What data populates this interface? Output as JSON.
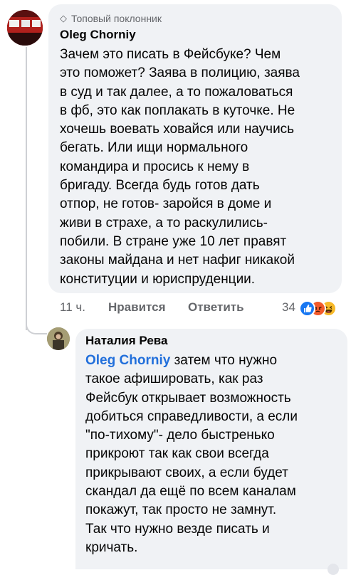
{
  "comment": {
    "badge": "Топовый поклонник",
    "author": "Oleg Chorniy",
    "lines": [
      "Зачем это писать в Фейсбуке? Чем",
      "это поможет? Заява в полицию, заява",
      "в суд и так далее, а то пожаловаться",
      "в фб, это как поплакать в куточке. Не",
      "хочешь воевать ховайся или научись",
      "бегать. Или ищи нормального",
      "командира и просись к нему в",
      "бригаду. Всегда будь готов дать",
      "отпор, не готов- заройся в доме и",
      "живи в страхе, а то раскулились-",
      "побили. В стране уже 10 лет правят",
      "законы майдана и нет нафиг никакой",
      "конституции и юриспруденции."
    ],
    "time": "11 ч.",
    "like_label": "Нравится",
    "reply_label": "Ответить",
    "reaction_count": "34",
    "reactions": [
      "like-icon",
      "angry-icon",
      "haha-icon"
    ]
  },
  "reply": {
    "author": "Наталия Рева",
    "mention": "Oleg Chorniy",
    "lines": [
      "затем что нужно",
      "такое афишировать, как раз",
      "Фейсбук открывает возможность",
      "добиться справедливости, а если",
      "\"по-тихому\"- дело быстренько",
      "прикроют так как свои всегда",
      "прикрывают своих, а если будет",
      "скандал да ещё по всем каналам",
      "покажут, так просто не замнут.",
      "Так что нужно везде писать и",
      "кричать."
    ]
  },
  "colors": {
    "bubble": "#f0f2f5",
    "secondary_text": "#65676b",
    "mention": "#216fdb",
    "like_reaction": "#1877f2",
    "angry_reaction": "#f25a2a",
    "haha_reaction": "#f7b928"
  }
}
